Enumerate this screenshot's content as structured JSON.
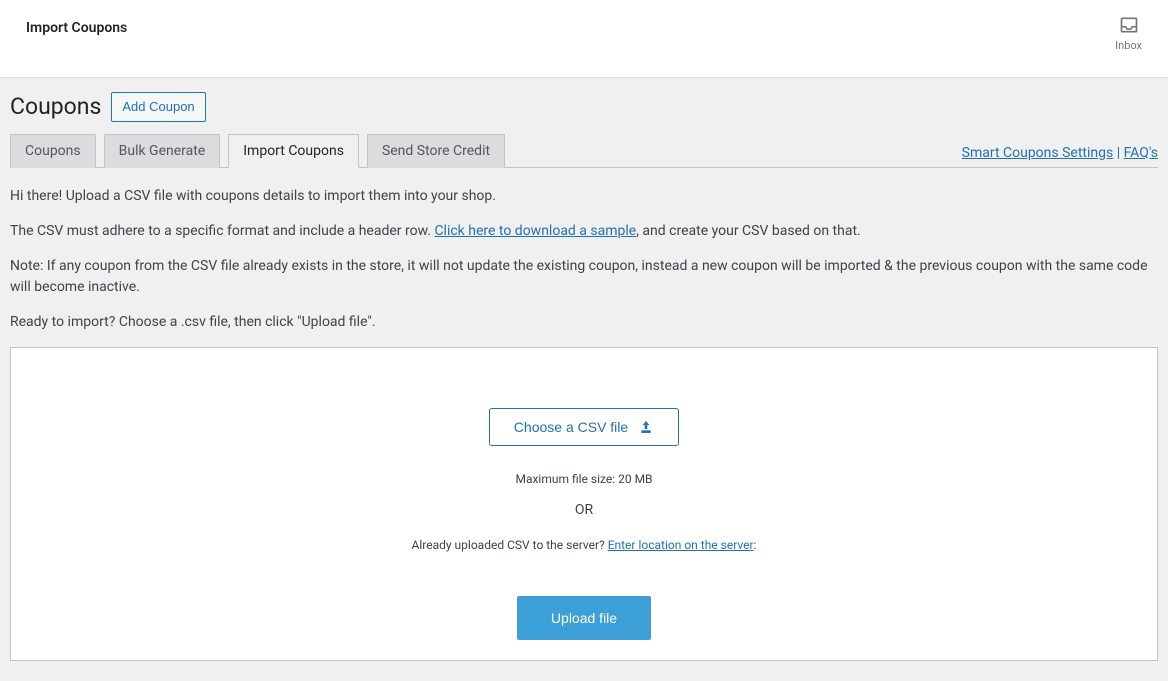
{
  "top_header": {
    "title": "Import Coupons",
    "inbox_label": "Inbox"
  },
  "page": {
    "heading": "Coupons",
    "add_coupon_label": "Add Coupon"
  },
  "tabs": [
    {
      "label": "Coupons",
      "active": false
    },
    {
      "label": "Bulk Generate",
      "active": false
    },
    {
      "label": "Import Coupons",
      "active": true
    },
    {
      "label": "Send Store Credit",
      "active": false
    }
  ],
  "settings_links": {
    "settings": "Smart Coupons Settings",
    "separator": " | ",
    "faqs": "FAQ's"
  },
  "intro": {
    "p1": "Hi there! Upload a CSV file with coupons details to import them into your shop.",
    "p2_prefix": "The CSV must adhere to a specific format and include a header row. ",
    "p2_link": "Click here to download a sample",
    "p2_suffix": ", and create your CSV based on that.",
    "p3": "Note: If any coupon from the CSV file already exists in the store, it will not update the existing coupon, instead a new coupon will be imported & the previous coupon with the same code will become inactive.",
    "p4": "Ready to import? Choose a .csv file, then click \"Upload file\"."
  },
  "upload_panel": {
    "choose_file_label": "Choose a CSV file",
    "max_size": "Maximum file size: 20 MB",
    "or": "OR",
    "already_uploaded_prefix": "Already uploaded CSV to the server? ",
    "already_uploaded_link": "Enter location on the server",
    "already_uploaded_suffix": ":",
    "upload_btn_label": "Upload file"
  }
}
